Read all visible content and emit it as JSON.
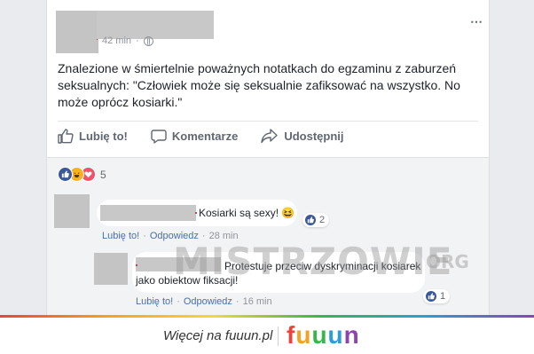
{
  "post": {
    "time": "42 min",
    "more_icon": "⋯",
    "text": "Znalezione w śmiertelnie poważnych notatkach do egzaminu z zaburzeń seksualnych: \"Człowiek może się seksualnie zafiksować na wszystko. No może oprócz kosiarki.\""
  },
  "actions": {
    "like": "Lubię to!",
    "comment": "Komentarze",
    "share": "Udostępnij"
  },
  "reactions": {
    "count": "5",
    "icons": [
      "like-icon",
      "haha-icon",
      "love-icon"
    ]
  },
  "comments": [
    {
      "text": "Kosiarki są sexy! 😆",
      "like_label": "Lubię to!",
      "reply_label": "Odpowiedz",
      "time": "28 min",
      "likes": "2"
    },
    {
      "text": "Protestuje przeciw dyskryminacji kosiarek jako obiektow fiksacji!",
      "like_label": "Lubię to!",
      "reply_label": "Odpowiedz",
      "time": "16 min",
      "likes": "1"
    }
  ],
  "watermark": {
    "main": "MISTRZOWIE",
    "suffix": "ORG"
  },
  "footer": {
    "text": "Więcej na fuuun.pl",
    "logo_letters": [
      "f",
      "u",
      "u",
      "u",
      "n"
    ],
    "logo_colors": [
      "#e8453c",
      "#f7a021",
      "#3ab54a",
      "#2d9cdb",
      "#8e44ad"
    ]
  },
  "colors": {
    "link": "#4b6fa8",
    "text": "#1d2129",
    "muted": "#90949c",
    "fb_blue": "#3b5998"
  }
}
